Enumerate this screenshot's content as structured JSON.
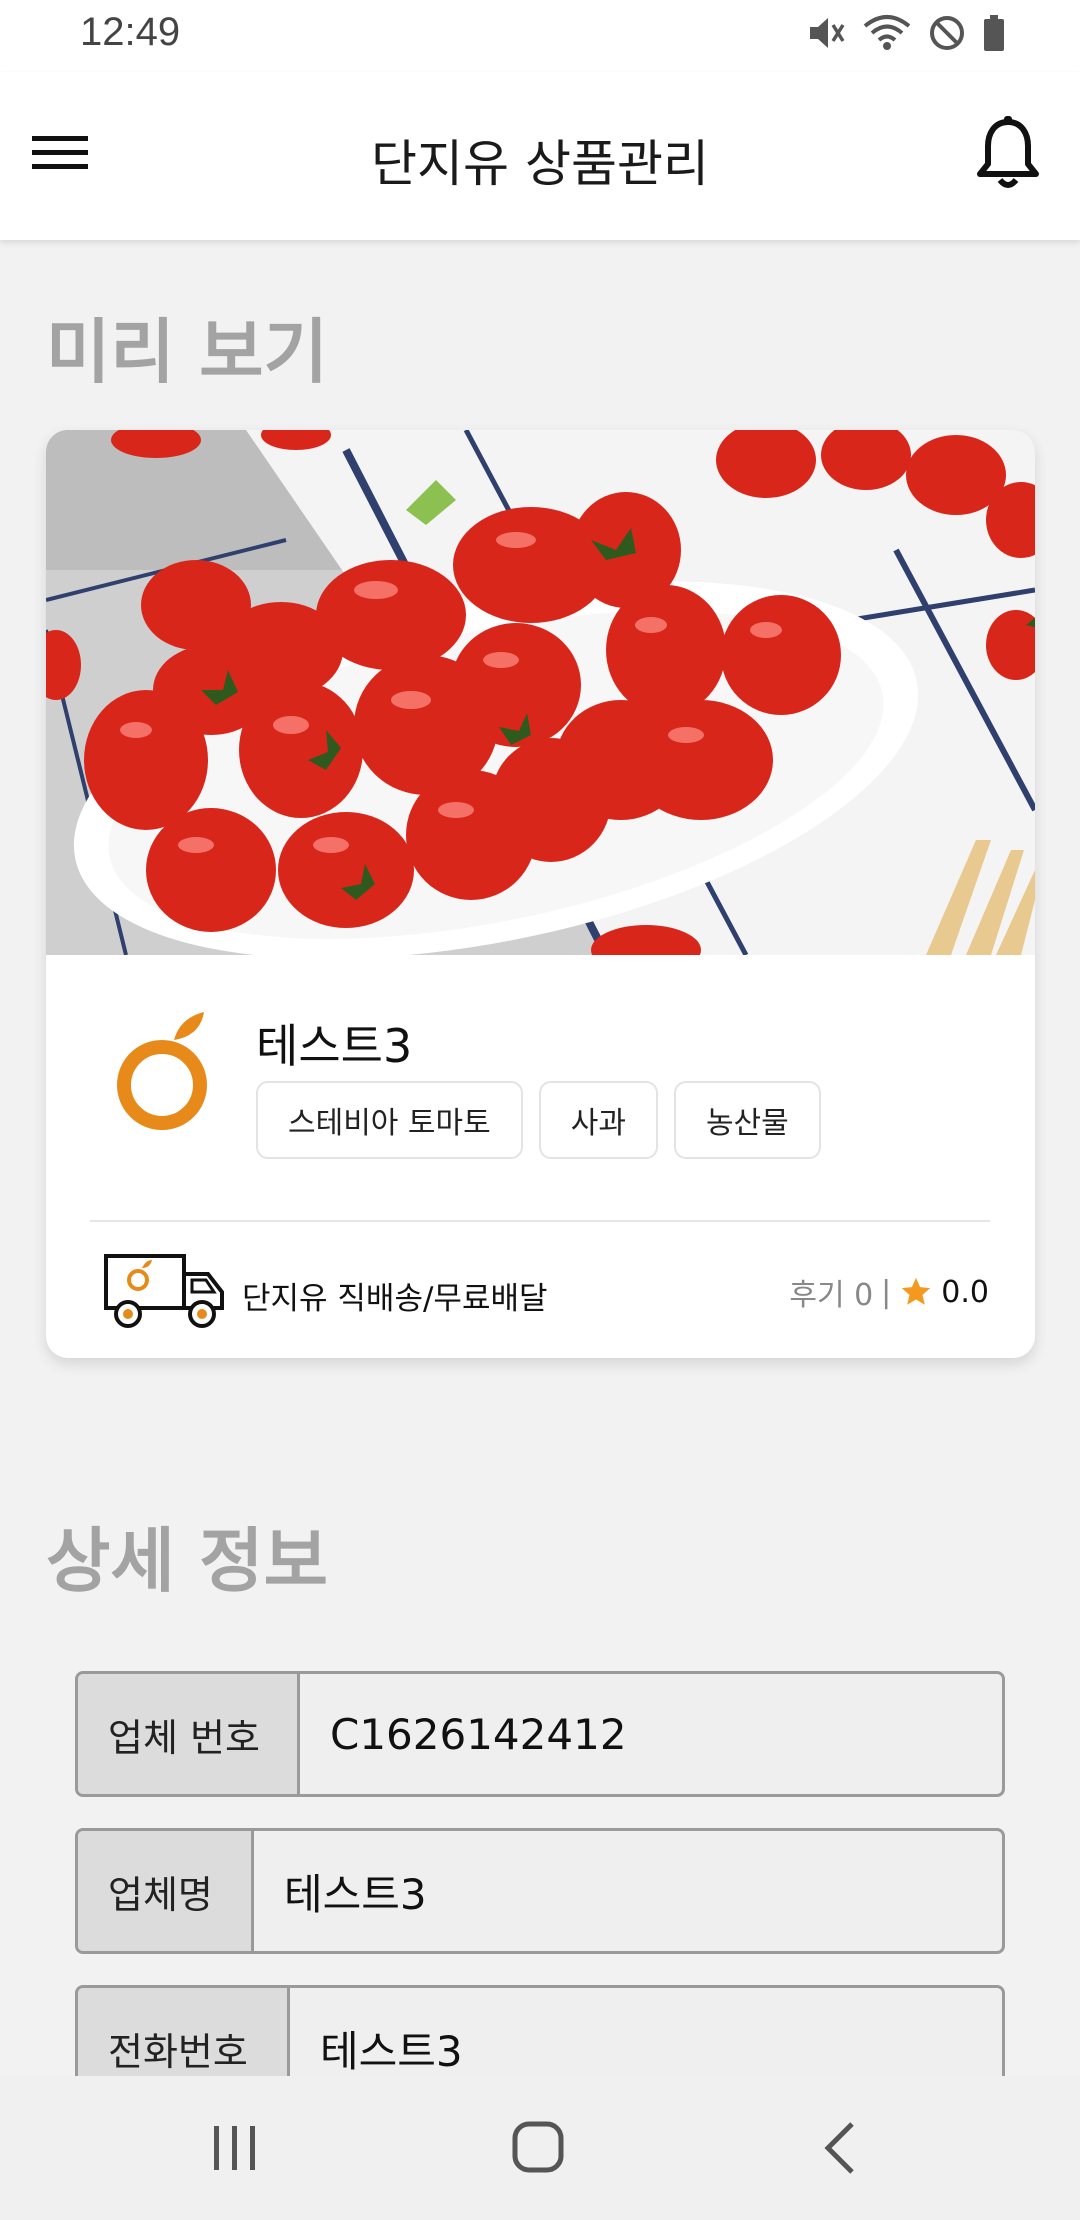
{
  "status_bar": {
    "time": "12:49",
    "icons": [
      "mute-icon",
      "wifi-icon",
      "do-not-disturb-icon",
      "battery-icon"
    ]
  },
  "app_bar": {
    "title": "단지유 상품관리",
    "menu_icon": "hamburger-menu-icon",
    "bell_icon": "bell-icon"
  },
  "preview": {
    "section_title": "미리 보기",
    "product_image": "cherry-tomatoes-photo",
    "product_name": "테스트3",
    "tags": [
      "스테비아 토마토",
      "사과",
      "농산물"
    ],
    "delivery_text": "단지유 직배송/무료배달",
    "review_label": "후기 0",
    "review_separator": "|",
    "rating": "0.0"
  },
  "detail": {
    "section_title": "상세 정보",
    "fields": [
      {
        "label": "업체 번호",
        "value": "C1626142412"
      },
      {
        "label": "업체명",
        "value": "테스트3"
      },
      {
        "label": "전화번호",
        "value": "테스트3"
      }
    ]
  },
  "nav_bar": {
    "icons": [
      "recents-icon",
      "home-icon",
      "back-icon"
    ]
  },
  "colors": {
    "accent_orange": "#e88a1a",
    "section_title_gray": "#a3a3a3",
    "star_orange": "#f39a1e"
  }
}
